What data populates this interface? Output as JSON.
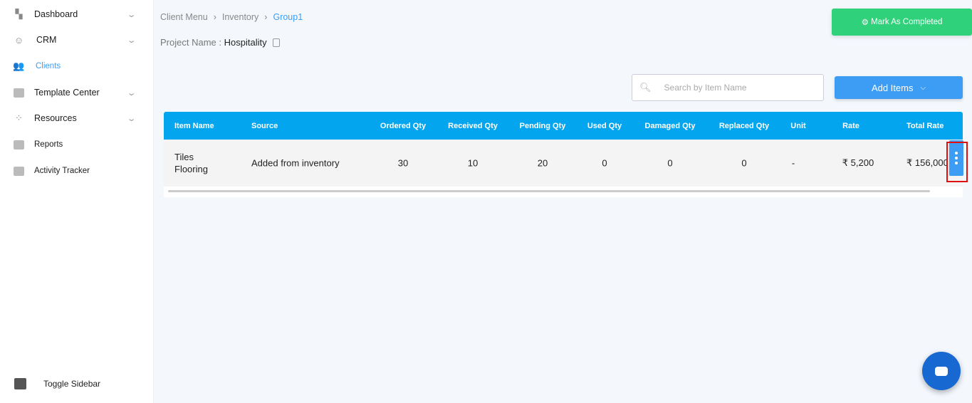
{
  "sidebar": {
    "items": [
      {
        "label": "Dashboard",
        "icon": "dashboard-icon",
        "chevron": true
      },
      {
        "label": "CRM",
        "icon": "crm-icon",
        "chevron": true
      },
      {
        "label": "Clients",
        "icon": "clients-icon",
        "chevron": false,
        "active": true
      },
      {
        "label": "Template Center",
        "icon": "template-icon",
        "chevron": true
      },
      {
        "label": "Resources",
        "icon": "resources-icon",
        "chevron": true
      },
      {
        "label": "Reports",
        "icon": "reports-icon",
        "chevron": false
      },
      {
        "label": "Activity Tracker",
        "icon": "monitor-icon",
        "chevron": false
      }
    ],
    "toggle_label": "Toggle Sidebar"
  },
  "breadcrumb": [
    "Client Menu",
    "Inventory",
    "Group1"
  ],
  "project": {
    "label": "Project Name :",
    "value": "Hospitality"
  },
  "mark_completed_label": "Mark As Completed",
  "search": {
    "placeholder": "Search by Item Name"
  },
  "add_items_label": "Add Items",
  "table": {
    "headers": [
      "Item Name",
      "Source",
      "Ordered Qty",
      "Received Qty",
      "Pending Qty",
      "Used Qty",
      "Damaged Qty",
      "Replaced Qty",
      "Unit",
      "Rate",
      "Total Rate"
    ],
    "rows": [
      [
        "Tiles\nFlooring",
        "Added from inventory",
        "30",
        "10",
        "20",
        "0",
        "0",
        "0",
        "-",
        "₹ 5,200",
        "₹ 156,000"
      ]
    ]
  },
  "colors": {
    "accent": "#3d9cf4",
    "header": "#03a6ee",
    "success": "#2fd27b"
  }
}
